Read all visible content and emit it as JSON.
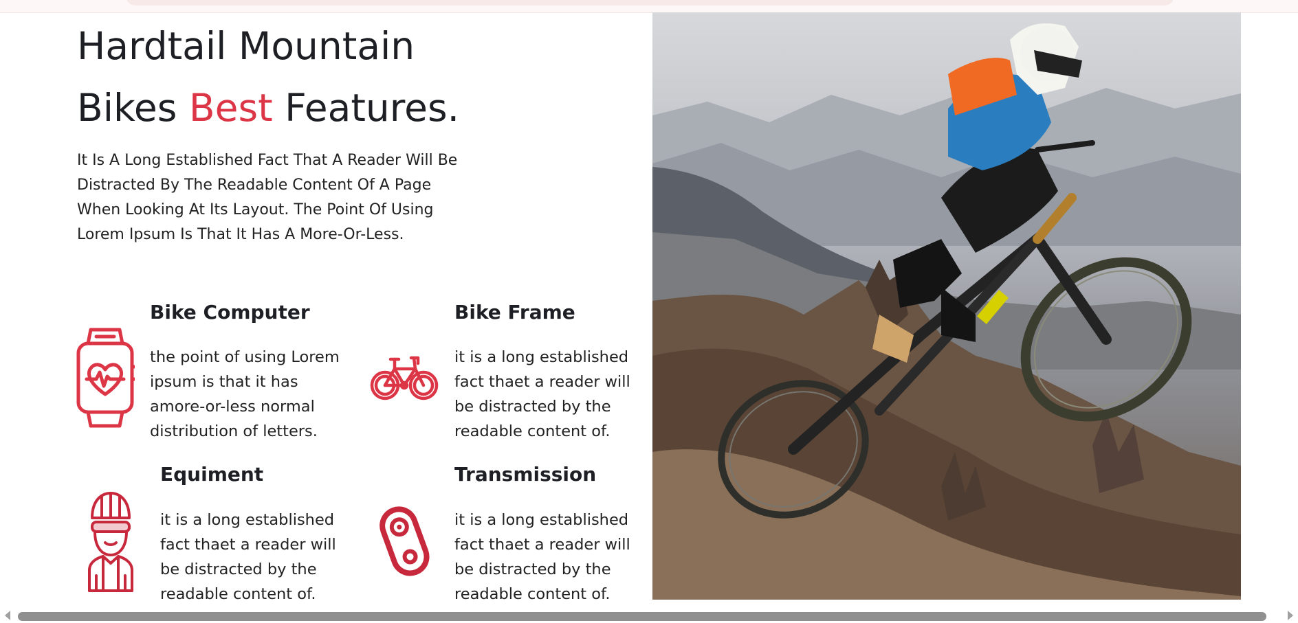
{
  "header": {
    "line1": "Hardtail Mountain",
    "line2_pre": "Bikes ",
    "line2_accent": "Best",
    "line2_post": " Features."
  },
  "intro": "It Is A Long Established Fact That A Reader Will Be Distracted By The Readable Content Of A Page When Looking At Its Layout. The Point Of Using Lorem Ipsum Is That It Has A More-Or-Less.",
  "features": [
    {
      "title": "Bike Computer",
      "text": "the point of using Lorem ipsum is that it has amore-or-less normal distribution of letters.",
      "icon": "smartwatch-heart-icon"
    },
    {
      "title": "Bike Frame",
      "text": "it is a long established fact thaet a reader will be distracted by the readable content of.",
      "icon": "bicycle-icon"
    },
    {
      "title": "Equiment",
      "text": "it is a long established fact thaet a reader will be distracted by the readable content of.",
      "icon": "cyclist-helmet-icon"
    },
    {
      "title": "Transmission",
      "text": "it is a long established fact thaet a reader will be distracted by the readable content of.",
      "icon": "chain-transmission-icon"
    }
  ],
  "hero_image": "mountain-bike-rider-jump-image",
  "colors": {
    "accent": "#dc3545",
    "text": "#212529",
    "scrollbar": "#8f8f8f"
  }
}
